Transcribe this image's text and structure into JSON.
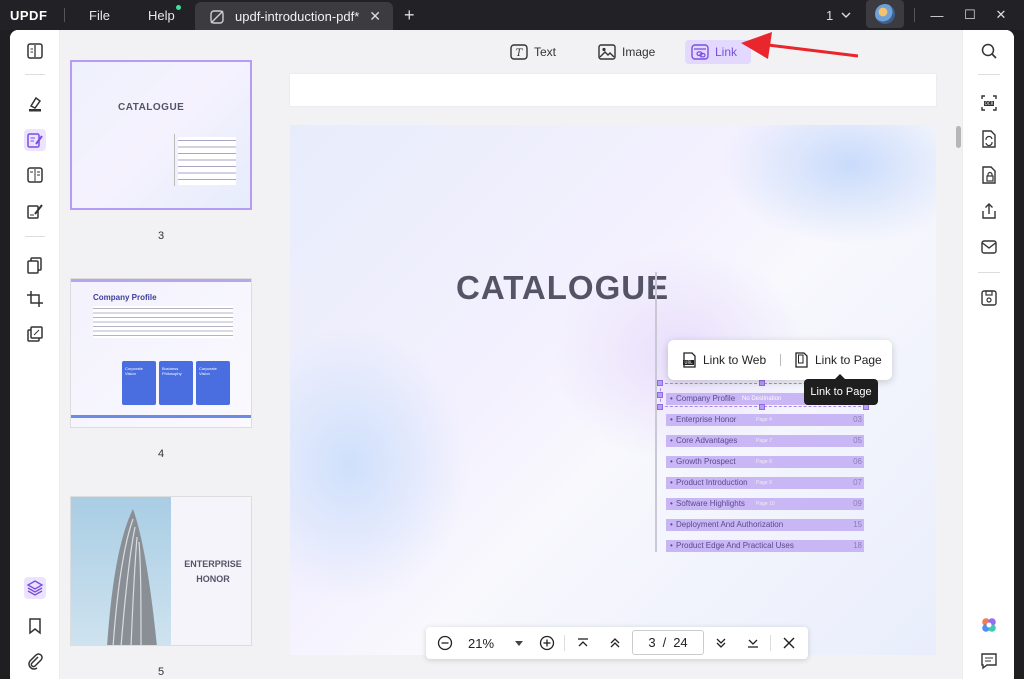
{
  "app": {
    "logo": "UPDF"
  },
  "menu": {
    "file": "File",
    "help": "Help"
  },
  "tab": {
    "title": "updf-introduction-pdf*",
    "close": "✕",
    "add": "+"
  },
  "titlebar": {
    "page_indicator": "1",
    "minimize": "—",
    "maximize": "☐",
    "close": "✕"
  },
  "toolbar": {
    "text": "Text",
    "image": "Image",
    "link": "Link"
  },
  "thumbnails": [
    {
      "number": "3",
      "title": "CATALOGUE"
    },
    {
      "number": "4",
      "title": "Company Profile",
      "cards": [
        "Corporate Vision",
        "Business Philosophy",
        "Corporate Vision"
      ]
    },
    {
      "number": "5",
      "title_line1": "ENTERPRISE",
      "title_line2": "HONOR"
    }
  ],
  "page": {
    "title": "CATALOGUE",
    "toc": [
      {
        "label": "Company Profile",
        "page": "No Destination",
        "num": ""
      },
      {
        "label": "Enterprise Honor",
        "page": "Page 4",
        "num": "03"
      },
      {
        "label": "Core Advantages",
        "page": "Page 7",
        "num": "05"
      },
      {
        "label": "Growth Prospect",
        "page": "Page 8",
        "num": "06"
      },
      {
        "label": "Product Introduction",
        "page": "Page 9",
        "num": "07"
      },
      {
        "label": "Software Highlights",
        "page": "Page 10",
        "num": "09"
      },
      {
        "label": "Deployment And Authorization",
        "page": "",
        "num": "15"
      },
      {
        "label": "Product Edge And Practical Uses",
        "page": "",
        "num": "18"
      }
    ]
  },
  "link_popup": {
    "web": "Link to Web",
    "page": "Link to Page"
  },
  "tooltip": "Link to Page",
  "zoom": {
    "level": "21%",
    "current_page": "3",
    "separator": "/",
    "total_pages": "24"
  },
  "colors": {
    "accent": "#8b5cf6",
    "link_highlight": "#c9b6f5",
    "annotation_arrow": "#e8262b"
  }
}
